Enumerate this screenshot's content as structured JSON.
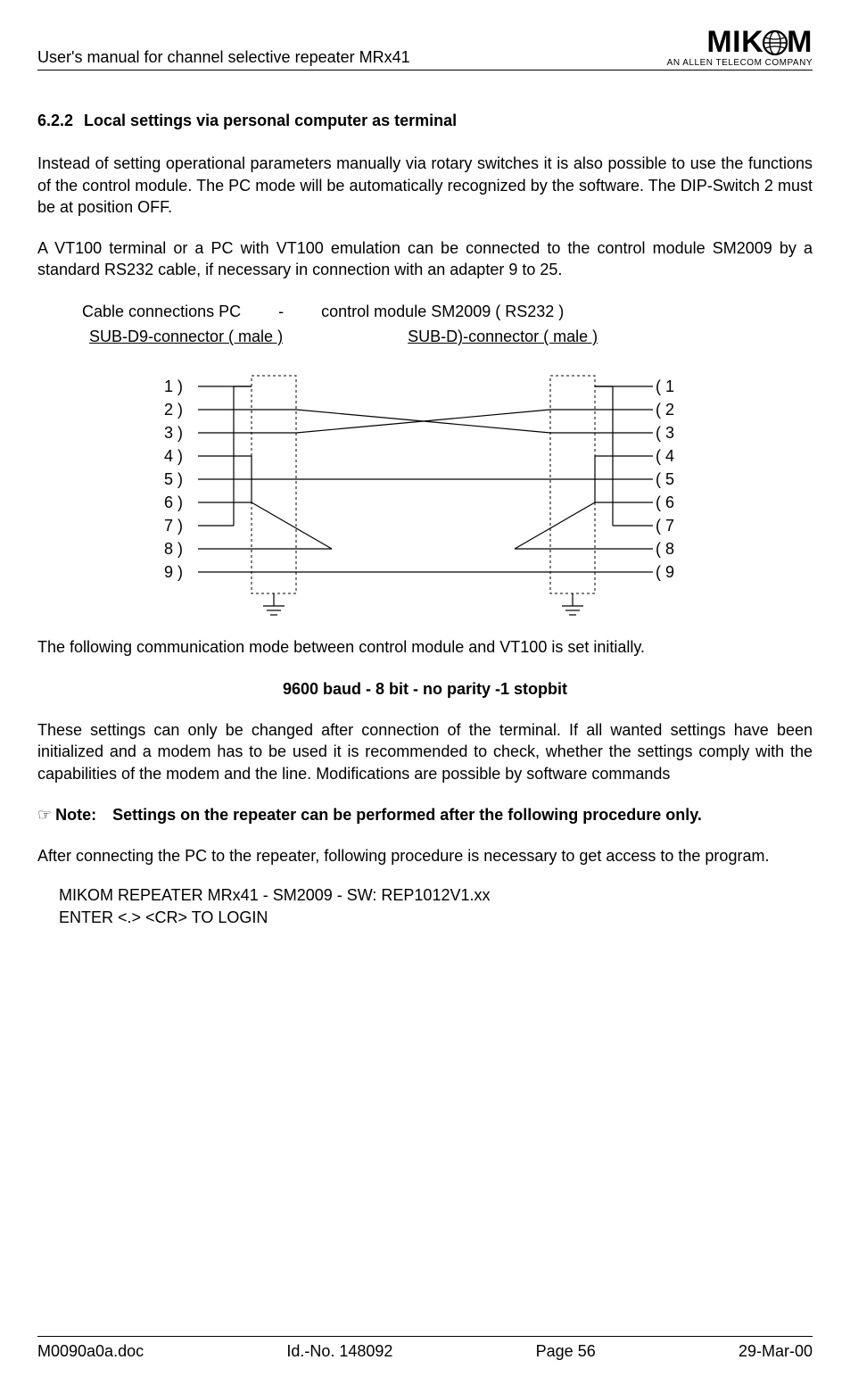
{
  "header": {
    "title": "User's manual for channel selective repeater MRx41",
    "logo_main_left": "MIK",
    "logo_main_right": "M",
    "logo_sub": "AN ALLEN TELECOM COMPANY"
  },
  "section": {
    "number": "6.2.2",
    "title": "Local settings via personal computer as terminal"
  },
  "para1": "Instead of setting operational parameters manually via rotary switches it is also possible to use the functions of the control module. The PC mode will be automatically recognized by the software. The DIP-Switch 2 must be at position OFF.",
  "para2": "A VT100 terminal or a PC with VT100 emulation can be connected to the control module SM2009 by a standard RS232 cable, if necessary in connection with an adapter 9 to 25.",
  "cable": {
    "line1_left": "Cable connections PC",
    "line1_sep": "-",
    "line1_right": "control module SM2009 ( RS232 )",
    "line2_left": "SUB-D9-connector ( male )",
    "line2_right": "SUB-D)-connector ( male )"
  },
  "diagram": {
    "left_pins": [
      "1  )",
      "2  )",
      "3  )",
      "4  )",
      "5  )",
      "6  )",
      "7  )",
      "8  )",
      "9  )"
    ],
    "right_pins": [
      "(  1",
      "(  2",
      "(  3",
      "(  4",
      "(  5",
      "(  6",
      "(  7",
      "(  8",
      "(  9"
    ]
  },
  "para3": "The following communication mode between control module and VT100 is set initially.",
  "comm_mode": "9600 baud - 8 bit - no parity -1 stopbit",
  "para4": "These settings can only be changed after connection of the terminal. If all wanted settings have been initialized and a modem has to be used it is recommended to check, whether the settings comply with the capabilities of the modem and the line. Modifications are possible by software commands",
  "note": {
    "pointer": "☞",
    "label": "Note:",
    "text": "Settings on the repeater can be performed after the following procedure only."
  },
  "para5": "After connecting the PC to the repeater, following procedure is necessary to get access to the program.",
  "terminal": {
    "line1": "MIKOM REPEATER MRx41 - SM2009 - SW: REP1012V1.xx",
    "line2": "ENTER <.> <CR> TO LOGIN"
  },
  "footer": {
    "left": "M0090a0a.doc",
    "center_left": "Id.-No. 148092",
    "center_right": "Page 56",
    "right": "29-Mar-00"
  }
}
